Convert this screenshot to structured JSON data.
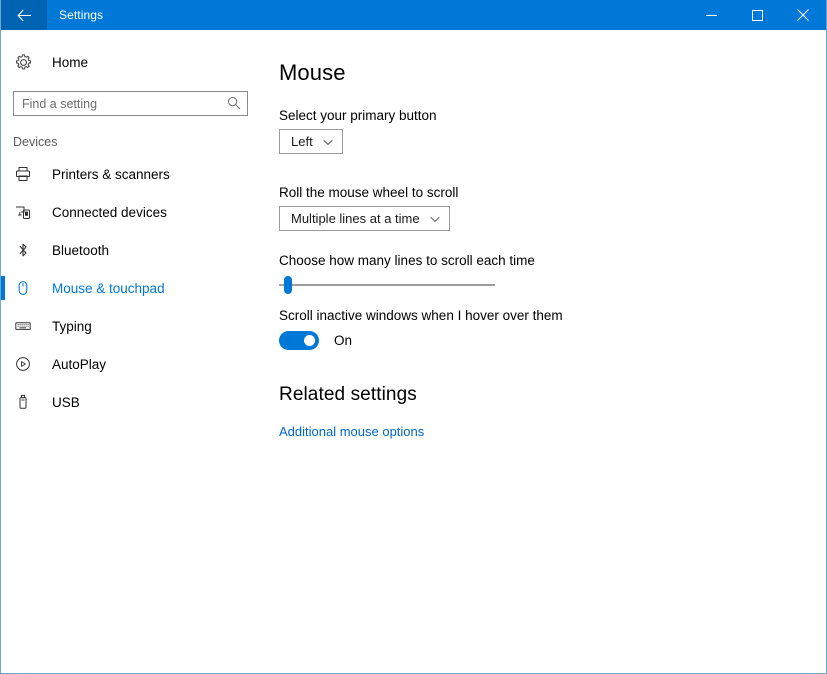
{
  "titlebar": {
    "back_icon": "back-arrow-icon",
    "title": "Settings",
    "minimize_icon": "minimize-icon",
    "maximize_icon": "maximize-icon",
    "close_icon": "close-icon",
    "bg_color": "#0078d7"
  },
  "sidebar": {
    "home": {
      "icon": "gear-icon",
      "label": "Home"
    },
    "search": {
      "value": "",
      "placeholder": "Find a setting",
      "icon": "search-icon"
    },
    "section_label": "Devices",
    "items": [
      {
        "icon": "printer-icon",
        "label": "Printers & scanners",
        "selected": false
      },
      {
        "icon": "connected-devices-icon",
        "label": "Connected devices",
        "selected": false
      },
      {
        "icon": "bluetooth-icon",
        "label": "Bluetooth",
        "selected": false
      },
      {
        "icon": "mouse-icon",
        "label": "Mouse & touchpad",
        "selected": true
      },
      {
        "icon": "keyboard-icon",
        "label": "Typing",
        "selected": false
      },
      {
        "icon": "autoplay-icon",
        "label": "AutoPlay",
        "selected": false
      },
      {
        "icon": "usb-icon",
        "label": "USB",
        "selected": false
      }
    ],
    "accent_color": "#0078d7"
  },
  "main": {
    "page_title": "Mouse",
    "primary_button": {
      "label": "Select your primary button",
      "value": "Left",
      "chevron_icon": "chevron-down-icon"
    },
    "wheel_scroll": {
      "label": "Roll the mouse wheel to scroll",
      "value": "Multiple lines at a time",
      "chevron_icon": "chevron-down-icon"
    },
    "lines_slider": {
      "label": "Choose how many lines to scroll each time",
      "percent": 4
    },
    "inactive_scroll": {
      "label": "Scroll inactive windows when I hover over them",
      "state": "On"
    },
    "related": {
      "title": "Related settings",
      "link": "Additional mouse options",
      "link_color": "#0066cc"
    }
  }
}
